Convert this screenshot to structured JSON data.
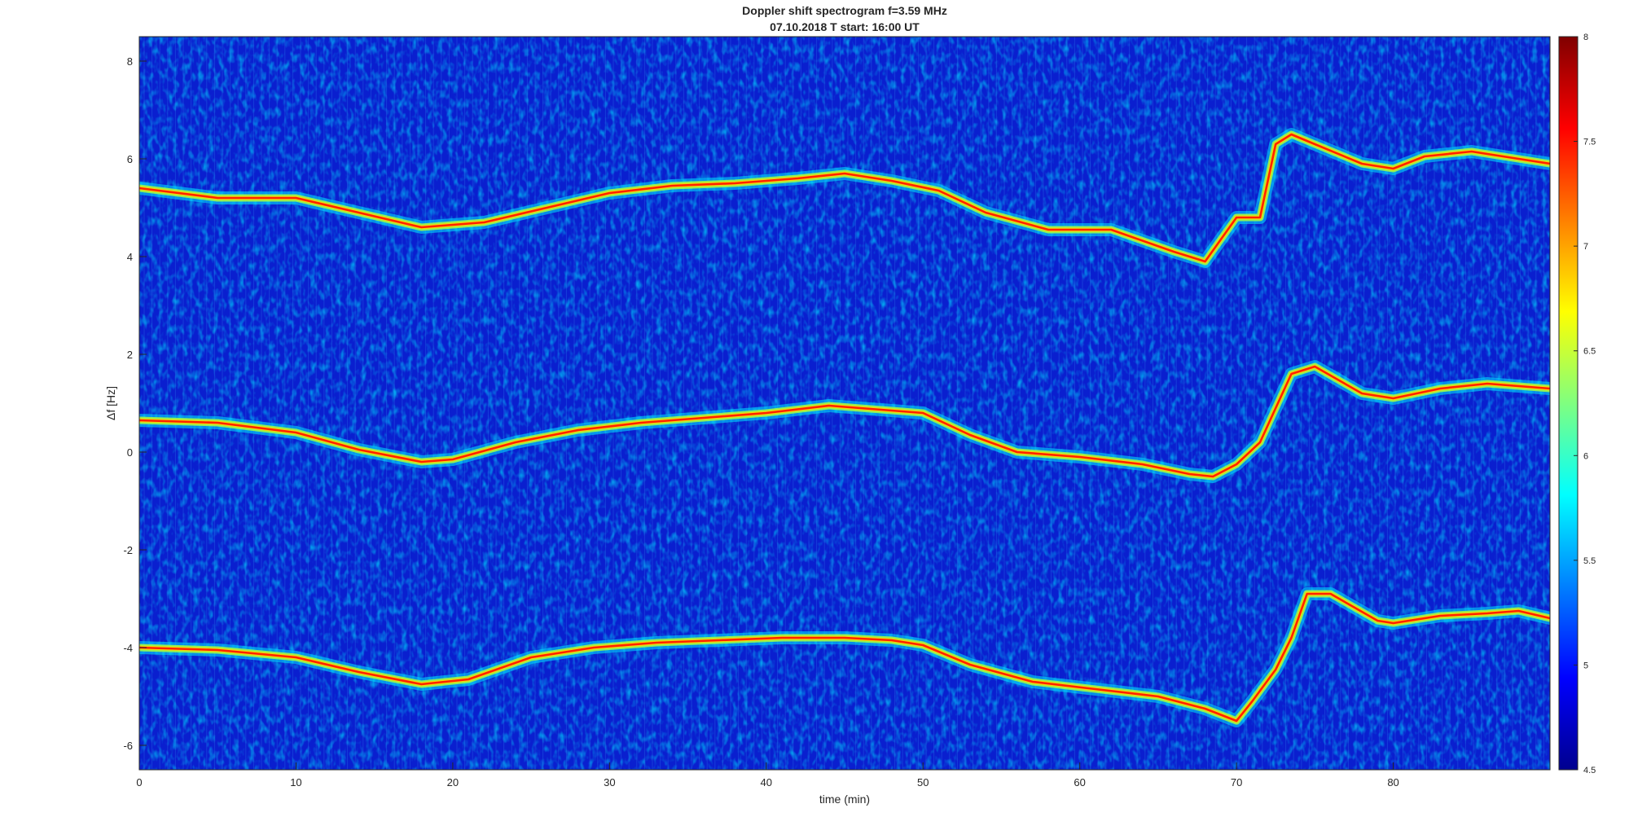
{
  "title": "Doppler shift spectrogram f=3.59 MHz",
  "subtitle": "07.10.2018   T start: 16:00 UT",
  "chart_data": {
    "type": "heatmap",
    "xlabel": "time (min)",
    "ylabel": "Δf [Hz]",
    "xlim": [
      0,
      90
    ],
    "ylim": [
      -6.5,
      8.5
    ],
    "x_ticks": [
      "0",
      "10",
      "20",
      "30",
      "40",
      "50",
      "60",
      "70",
      "80"
    ],
    "y_ticks": [
      "-6",
      "-4",
      "-2",
      "0",
      "2",
      "4",
      "6",
      "8"
    ],
    "colorbar": {
      "range": [
        4.5,
        8
      ],
      "ticks": [
        "4.5",
        "5",
        "5.5",
        "6",
        "6.5",
        "7",
        "7.5",
        "8"
      ],
      "colormap": "jet"
    },
    "series": [
      {
        "x": [
          0,
          5,
          10,
          14,
          18,
          22,
          26,
          30,
          34,
          38,
          42,
          45,
          48,
          51,
          54,
          58,
          62,
          66,
          68,
          70,
          71.5,
          72.5,
          73.5,
          75,
          78,
          80,
          82,
          85,
          88,
          90
        ],
        "y": [
          5.4,
          5.2,
          5.2,
          4.9,
          4.6,
          4.7,
          5.0,
          5.3,
          5.45,
          5.5,
          5.6,
          5.7,
          5.55,
          5.35,
          4.9,
          4.55,
          4.55,
          4.1,
          3.9,
          4.8,
          4.8,
          6.3,
          6.5,
          6.3,
          5.9,
          5.8,
          6.05,
          6.15,
          6.0,
          5.9
        ]
      },
      {
        "x": [
          0,
          5,
          10,
          14,
          18,
          20,
          24,
          28,
          32,
          36,
          40,
          44,
          48,
          50,
          53,
          56,
          60,
          64,
          67,
          68.5,
          70,
          71.5,
          72.5,
          73.5,
          75,
          78,
          80,
          83,
          86,
          88,
          90
        ],
        "y": [
          0.65,
          0.6,
          0.4,
          0.05,
          -0.2,
          -0.15,
          0.2,
          0.45,
          0.6,
          0.7,
          0.8,
          0.95,
          0.85,
          0.8,
          0.35,
          0.0,
          -0.1,
          -0.25,
          -0.45,
          -0.5,
          -0.25,
          0.2,
          0.9,
          1.6,
          1.75,
          1.2,
          1.1,
          1.3,
          1.4,
          1.35,
          1.3
        ]
      },
      {
        "x": [
          0,
          5,
          10,
          14,
          18,
          21,
          25,
          29,
          33,
          37,
          41,
          45,
          48,
          50,
          53,
          57,
          61,
          65,
          68,
          70,
          71,
          72.5,
          73.5,
          74.5,
          76,
          79,
          80,
          83,
          86,
          88,
          90
        ],
        "y": [
          -4.0,
          -4.05,
          -4.2,
          -4.5,
          -4.75,
          -4.65,
          -4.2,
          -4.0,
          -3.9,
          -3.85,
          -3.8,
          -3.8,
          -3.85,
          -3.95,
          -4.35,
          -4.7,
          -4.85,
          -5.0,
          -5.25,
          -5.5,
          -5.1,
          -4.45,
          -3.8,
          -2.9,
          -2.9,
          -3.45,
          -3.5,
          -3.35,
          -3.3,
          -3.25,
          -3.4
        ]
      }
    ]
  }
}
